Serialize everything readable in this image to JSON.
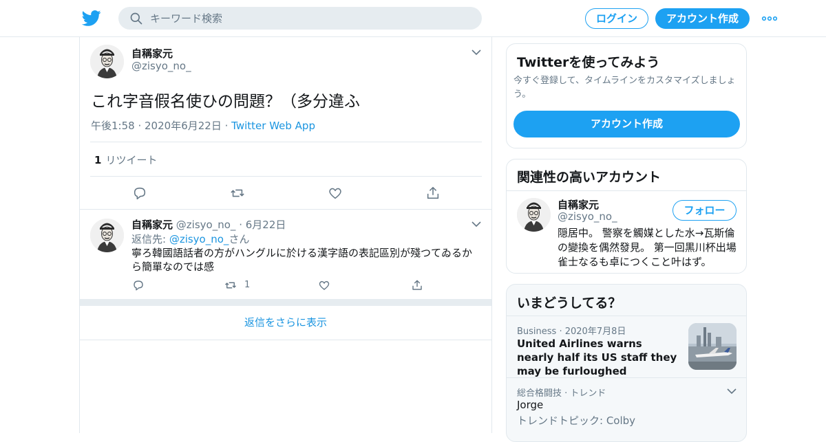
{
  "header": {
    "search_placeholder": "キーワード検索",
    "login_label": "ログイン",
    "signup_label": "アカウント作成"
  },
  "tweet": {
    "name": "自稱家元",
    "handle": "@zisyo_no_",
    "text": "これ字音假名使ひの問題？（多分違ふ",
    "time": "午後1:58",
    "date": "2020年6月22日",
    "app": "Twitter Web App",
    "retweet_count": "1",
    "retweet_label": "リツイート"
  },
  "reply": {
    "name": "自稱家元",
    "handle": "@zisyo_no_",
    "date": "6月22日",
    "reply_to_prefix": "返信先: ",
    "reply_to_handle": "@zisyo_no_",
    "reply_to_suffix": "さん",
    "text": "寧ろ韓國語話者の方がハングルに於ける漢字語の表記區別が殘つてゐるから簡單なのでは感",
    "retweet_count": "1"
  },
  "show_more_label": "返信をさらに表示",
  "signup_card": {
    "title": "Twitterを使ってみよう",
    "subtitle": "今すぐ登録して、タイムラインをカスタマイズしましょう。",
    "button": "アカウント作成"
  },
  "related_card": {
    "title": "関連性の高いアカウント",
    "name": "自稱家元",
    "handle": "@zisyo_no_",
    "follow_label": "フォロー",
    "bio": "隠居中。 警察を觸媒とした水→瓦斯倫の變換を偶然發見。 第一回黒川杯出場雀士なるも卓につくこと叶はず。"
  },
  "trends_card": {
    "title": "いまどうしてる？",
    "items": [
      {
        "category": "Business",
        "date": "2020年7月8日",
        "title": "United Airlines warns nearly half its US staff they may be furloughed"
      },
      {
        "category": "総合格闘技 · トレンド",
        "title": "Jorge",
        "subtitle": "トレンドトピック: Colby"
      }
    ]
  },
  "colors": {
    "accent": "#1da1f2",
    "link": "#1b95e0",
    "secondary_text": "#657786",
    "border": "#e1e8ed"
  }
}
